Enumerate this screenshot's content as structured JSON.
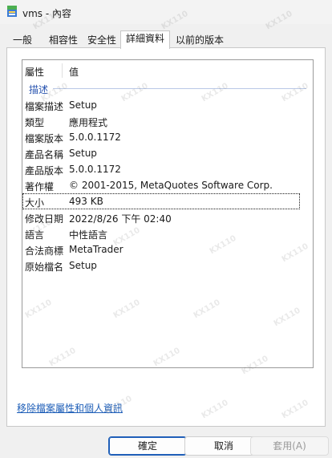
{
  "window": {
    "title": "vms - 內容"
  },
  "tabs": [
    {
      "label": "一般",
      "active": false
    },
    {
      "label": "相容性",
      "active": false
    },
    {
      "label": "安全性",
      "active": false
    },
    {
      "label": "詳細資料",
      "active": true
    },
    {
      "label": "以前的版本",
      "active": false
    }
  ],
  "details": {
    "header": {
      "property": "屬性",
      "value": "值"
    },
    "group": "描述",
    "rows": [
      {
        "property": "檔案描述",
        "value": "Setup"
      },
      {
        "property": "類型",
        "value": "應用程式"
      },
      {
        "property": "檔案版本",
        "value": "5.0.0.1172"
      },
      {
        "property": "產品名稱",
        "value": "Setup"
      },
      {
        "property": "產品版本",
        "value": "5.0.0.1172"
      },
      {
        "property": "著作權",
        "value": "© 2001-2015, MetaQuotes Software Corp."
      },
      {
        "property": "大小",
        "value": "493 KB",
        "selected": true
      },
      {
        "property": "修改日期",
        "value": "2022/8/26 下午 02:40"
      },
      {
        "property": "語言",
        "value": "中性語言"
      },
      {
        "property": "合法商標",
        "value": "MetaTrader"
      },
      {
        "property": "原始檔名",
        "value": "Setup"
      }
    ]
  },
  "remove_link": "移除檔案屬性和個人資訊",
  "buttons": {
    "ok": "確定",
    "cancel": "取消",
    "apply": "套用(A)"
  },
  "watermark": "KX110"
}
